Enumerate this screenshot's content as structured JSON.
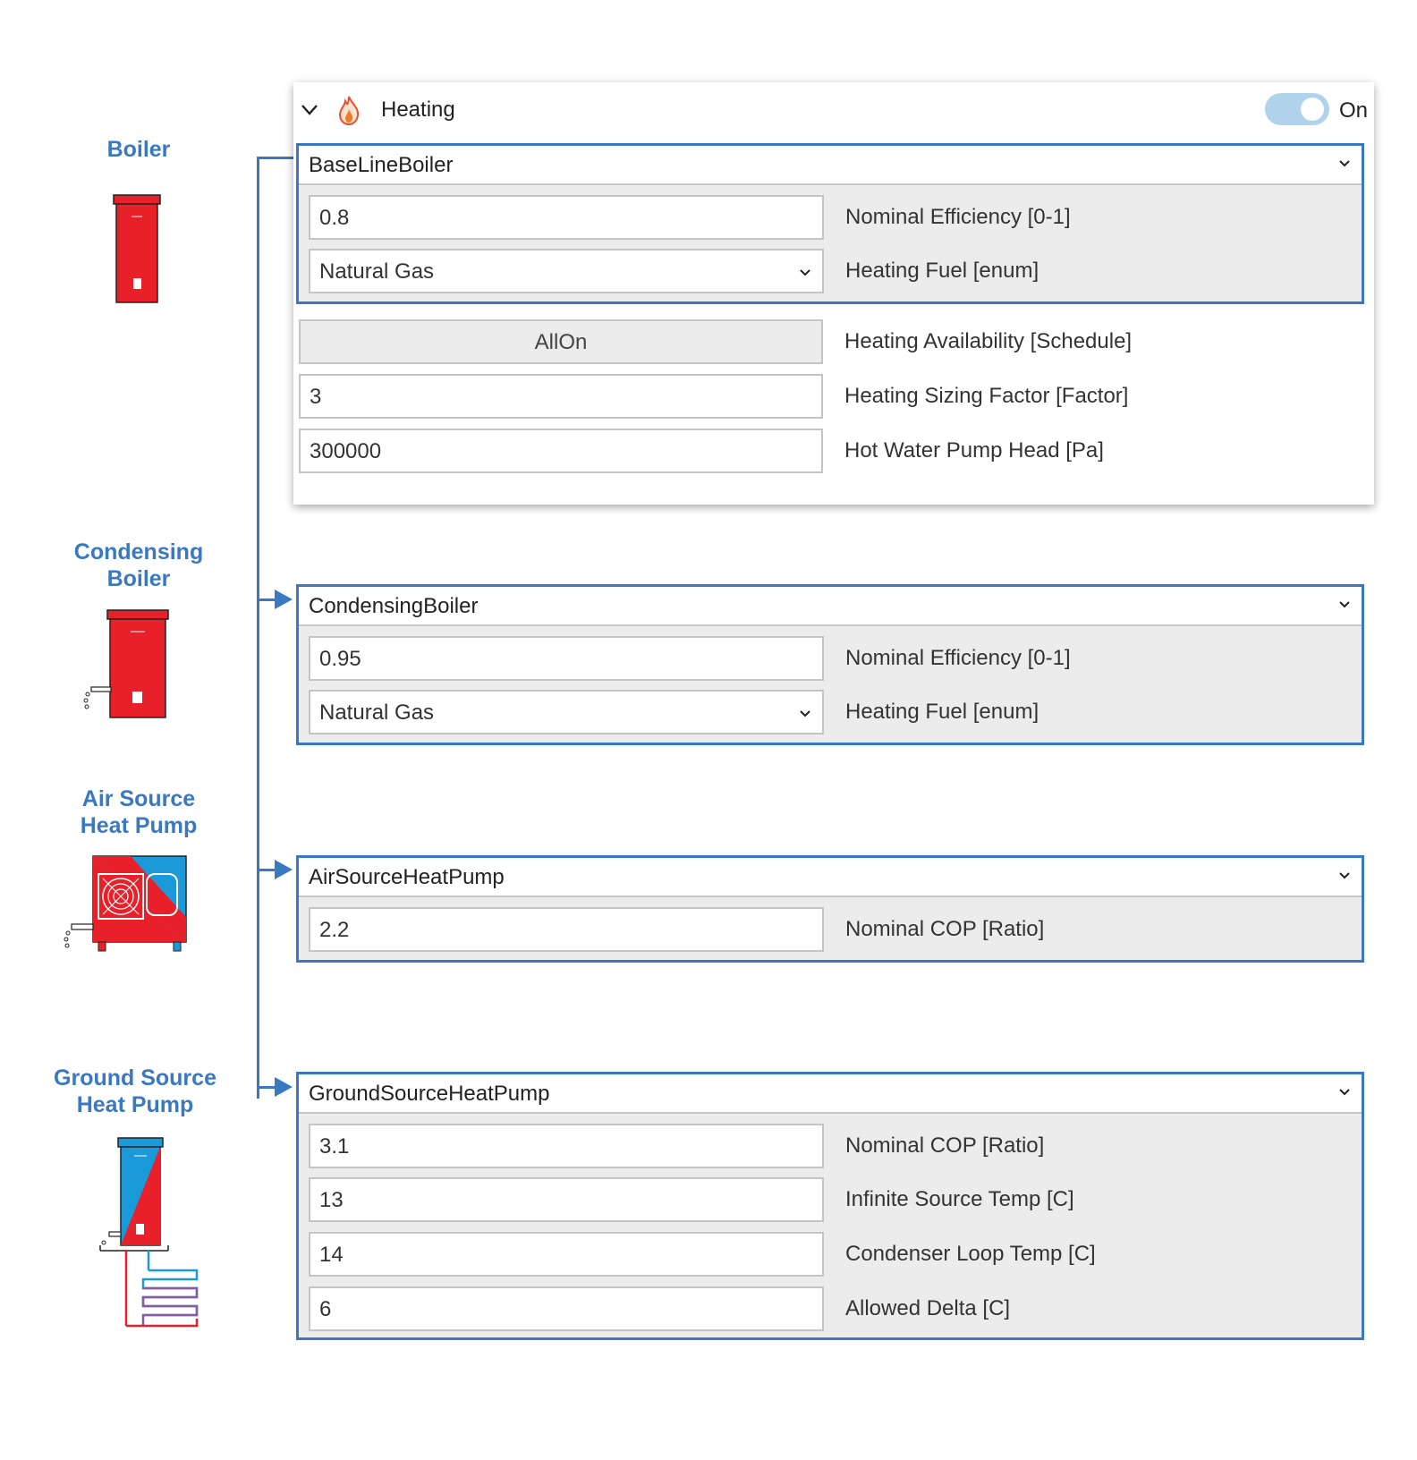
{
  "equipment": [
    {
      "label_line1": "Boiler",
      "label_line2": "",
      "icon": "boiler-icon"
    },
    {
      "label_line1": "Condensing",
      "label_line2": "Boiler",
      "icon": "condensing-boiler-icon"
    },
    {
      "label_line1": "Air Source",
      "label_line2": "Heat Pump",
      "icon": "air-source-heat-pump-icon"
    },
    {
      "label_line1": "Ground Source",
      "label_line2": "Heat Pump",
      "icon": "ground-source-heat-pump-icon"
    }
  ],
  "heating": {
    "title": "Heating",
    "toggle_label": "On",
    "toggle_on": true,
    "availability": {
      "value": "AllOn",
      "label": "Heating Availability [Schedule]"
    },
    "sizing_factor": {
      "value": "3",
      "label": "Heating Sizing Factor [Factor]"
    },
    "pump_head": {
      "value": "300000",
      "label": "Hot Water Pump Head [Pa]"
    }
  },
  "groups": [
    {
      "selected": "BaseLineBoiler",
      "fields": [
        {
          "value": "0.8",
          "label": "Nominal Efficiency [0-1]",
          "dropdown": false
        },
        {
          "value": "Natural Gas",
          "label": "Heating Fuel [enum]",
          "dropdown": true
        }
      ]
    },
    {
      "selected": "CondensingBoiler",
      "fields": [
        {
          "value": "0.95",
          "label": "Nominal Efficiency [0-1]",
          "dropdown": false
        },
        {
          "value": "Natural Gas",
          "label": "Heating Fuel [enum]",
          "dropdown": true
        }
      ]
    },
    {
      "selected": "AirSourceHeatPump",
      "fields": [
        {
          "value": "2.2",
          "label": "Nominal COP [Ratio]",
          "dropdown": false
        }
      ]
    },
    {
      "selected": "GroundSourceHeatPump",
      "fields": [
        {
          "value": "3.1",
          "label": "Nominal COP [Ratio]",
          "dropdown": false
        },
        {
          "value": "13",
          "label": "Infinite Source Temp [C]",
          "dropdown": false
        },
        {
          "value": "14",
          "label": "Condenser Loop Temp [C]",
          "dropdown": false
        },
        {
          "value": "6",
          "label": "Allowed Delta [C]",
          "dropdown": false
        }
      ]
    }
  ],
  "colors": {
    "accent": "#3b78c2",
    "boiler_red": "#e8202a",
    "heat_pump_blue": "#1a9ad9",
    "toggle": "#aed3ea"
  }
}
